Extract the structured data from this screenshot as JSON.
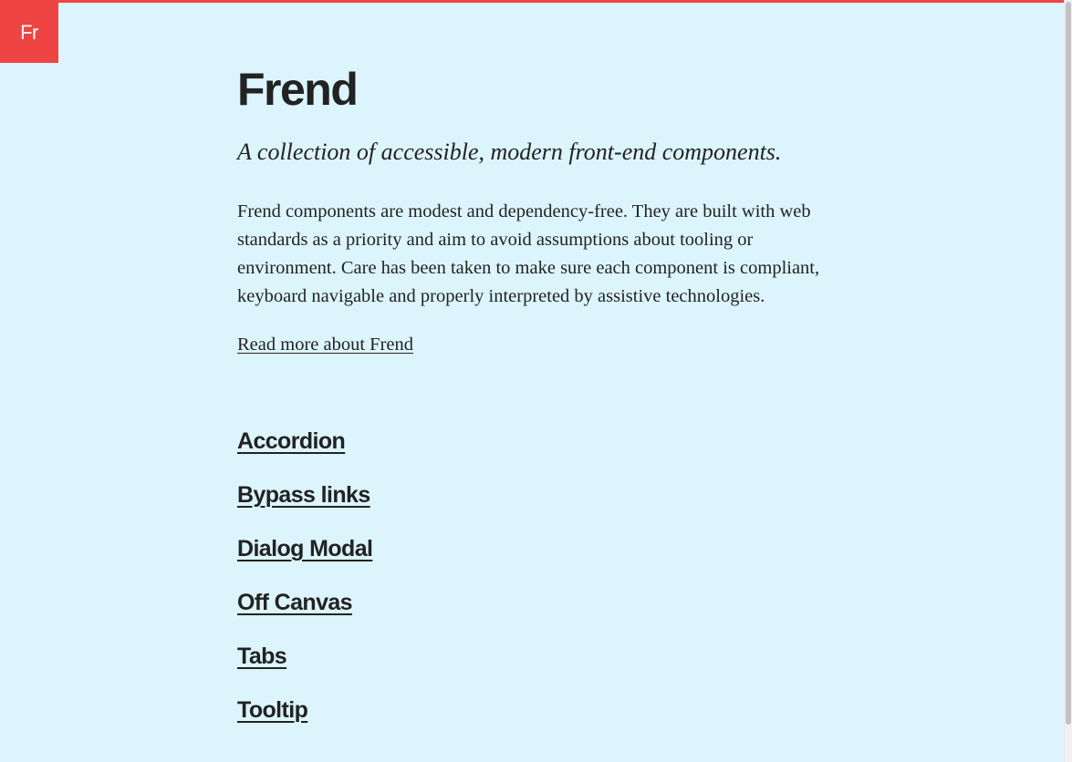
{
  "logo": {
    "text": "Fr"
  },
  "header": {
    "title": "Frend",
    "subtitle": "A collection of accessible, modern front-end components."
  },
  "intro": {
    "paragraph": "Frend components are modest and dependency-free. They are built with web standards as a priority and aim to avoid assumptions about tooling or environment. Care has been taken to make sure each component is compliant, keyboard navigable and properly interpreted by assistive technologies.",
    "read_more": "Read more about Frend"
  },
  "components": [
    {
      "label": "Accordion"
    },
    {
      "label": "Bypass links"
    },
    {
      "label": "Dialog Modal"
    },
    {
      "label": "Off Canvas"
    },
    {
      "label": "Tabs"
    },
    {
      "label": "Tooltip"
    }
  ],
  "colors": {
    "accent": "#ef4444",
    "background": "#dcf5fd",
    "text": "#222222"
  }
}
